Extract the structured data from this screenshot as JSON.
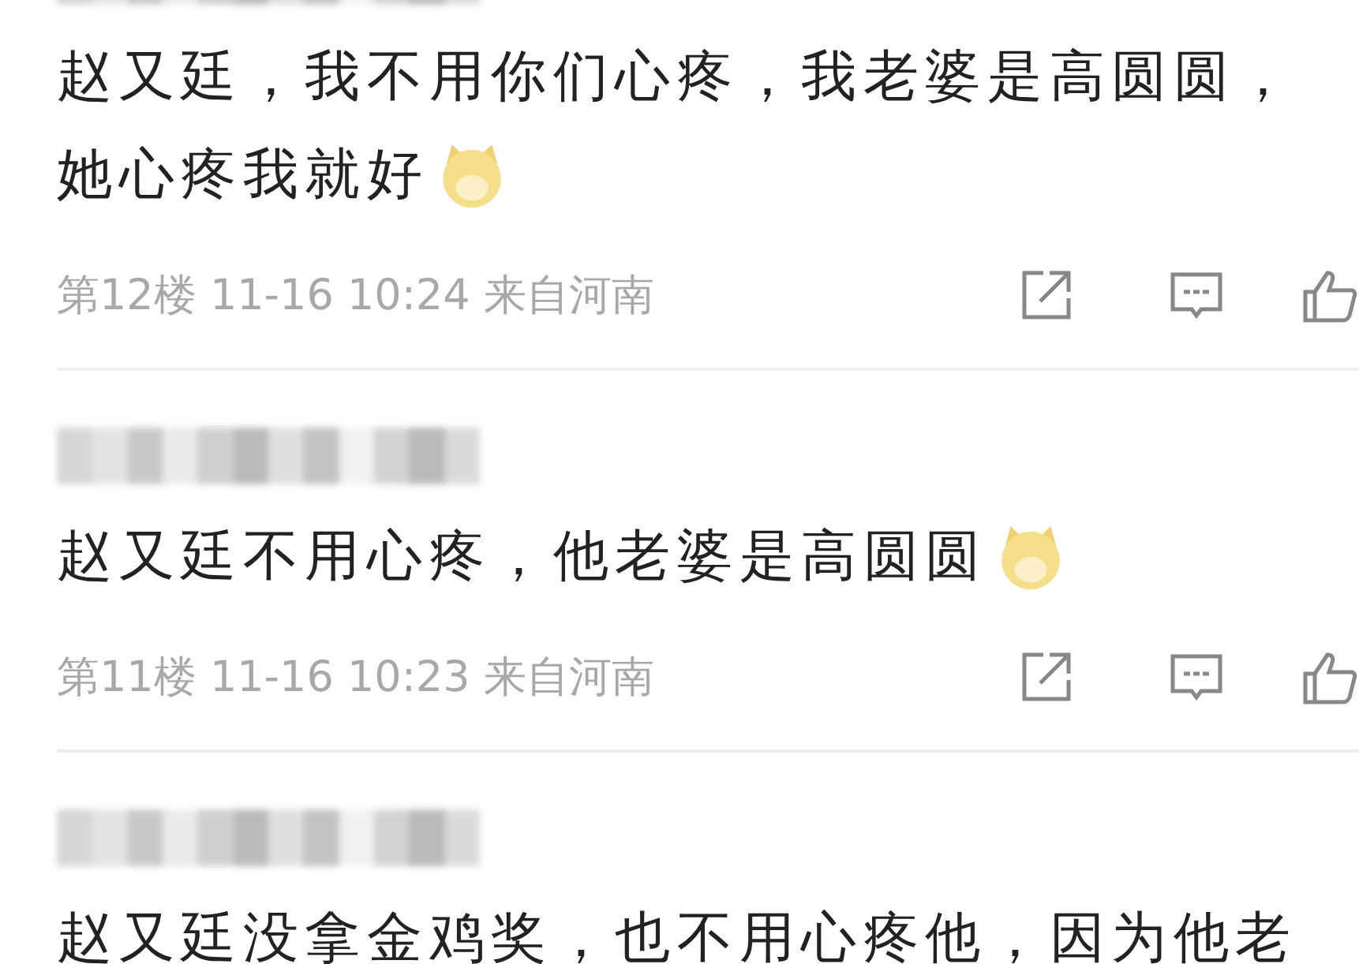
{
  "comments": [
    {
      "author_blurred": true,
      "lines": [
        "赵又廷，我不用你们心疼，我老婆是高圆圆，",
        "她心疼我就好"
      ],
      "emoji": true,
      "meta": "第12楼 11-16 10:24 来自河南"
    },
    {
      "author_blurred": true,
      "lines": [
        "赵又廷不用心疼，他老婆是高圆圆"
      ],
      "emoji": true,
      "meta": "第11楼 11-16 10:23 来自河南"
    },
    {
      "author_blurred": true,
      "lines": [
        "赵又廷没拿金鸡奖，也不用心疼他，因为他老"
      ]
    }
  ]
}
